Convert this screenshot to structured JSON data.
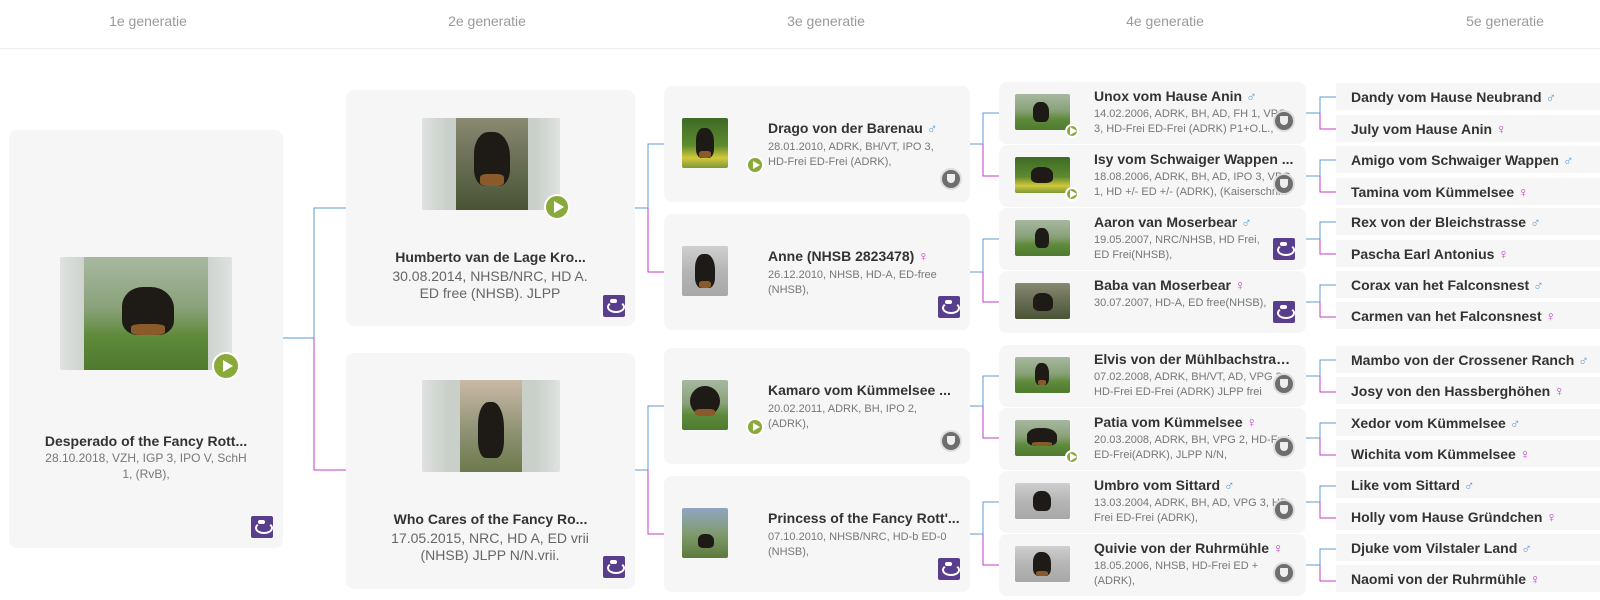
{
  "header": {
    "gen1": "1e generatie",
    "gen2": "2e generatie",
    "gen3": "3e generatie",
    "gen4": "4e generatie",
    "gen5": "5e generatie"
  },
  "colors": {
    "male": "#5b9bd5",
    "female": "#c43cc9",
    "play": "#8aa93b",
    "club": "#5a3e8e"
  },
  "sex_symbols": {
    "male": "♂",
    "female": "♀"
  },
  "gen1": {
    "name": "Desperado of the Fancy Rott...",
    "info": "28.10.2018, VZH, IGP 3, IPO V, SchH 1, (RvB),",
    "icons": [
      "video-play-icon",
      "breed-club-logo-icon"
    ]
  },
  "gen2": [
    {
      "name": "Humberto van de Lage Kro...",
      "info": "30.08.2014, NHSB/NRC, HD A. ED free (NHSB). JLPP",
      "sex": "male"
    },
    {
      "name": "Who Cares of the Fancy Ro...",
      "info": "17.05.2015, NRC, HD A, ED vrii (NHSB) JLPP N/N.vrii.",
      "sex": "female"
    }
  ],
  "gen3": [
    {
      "name": "Drago von der Barenau",
      "sex": "male",
      "info": "28.01.2010, ADRK, BH/VT, IPO 3, HD-Frei ED-Frei (ADRK),",
      "video": true,
      "badge": "shield"
    },
    {
      "name": "Anne (NHSB 2823478)",
      "sex": "female",
      "info": "26.12.2010, NHSB, HD-A, ED-free (NHSB),",
      "video": false,
      "badge": "club"
    },
    {
      "name": "Kamaro vom Kümmelsee ...",
      "sex": "male",
      "info": "20.02.2011, ADRK, BH, IPO 2, (ADRK),",
      "video": true,
      "badge": "shield"
    },
    {
      "name": "Princess of the Fancy Rott'...",
      "sex": "female",
      "info": "07.10.2010, NHSB/NRC, HD-b ED-0 (NHSB),",
      "video": false,
      "badge": "club"
    }
  ],
  "gen4": [
    {
      "name": "Unox vom Hause Anin",
      "sex": "male",
      "info": "14.02.2006, ADRK, BH, AD, FH 1, VPG 3, HD-Frei ED-Frei (ADRK) P1+O.L.,",
      "video": true,
      "badge": "shield"
    },
    {
      "name": "Isy vom Schwaiger Wappen ...",
      "sex": "female",
      "info": "18.08.2006, ADRK, BH, AD, IPO 3, VPG 1, HD +/- ED +/- (ADRK), (Kaiserschnitt",
      "video": true,
      "badge": "shield"
    },
    {
      "name": "Aaron van Moserbear",
      "sex": "male",
      "info": "19.05.2007, NRC/NHSB, HD Frei, ED Frei(NHSB),",
      "video": false,
      "badge": "club"
    },
    {
      "name": "Baba van Moserbear",
      "sex": "female",
      "info": "30.07.2007, HD-A, ED free(NHSB),",
      "video": false,
      "badge": "club"
    },
    {
      "name": "Elvis von der Mühlbachstras...",
      "sex": "male",
      "info": "07.02.2008, ADRK, BH/VT, AD, VPG 3, HD-Frei ED-Frei (ADRK) JLPP frei",
      "video": false,
      "badge": "shield"
    },
    {
      "name": "Patia vom Kümmelsee",
      "sex": "female",
      "info": "20.03.2008, ADRK, BH, VPG 2, HD-Frei ED-Frei(ADRK), JLPP N/N,",
      "video": true,
      "badge": "shield"
    },
    {
      "name": "Umbro vom Sittard",
      "sex": "male",
      "info": "13.03.2004, ADRK, BH, AD, VPG 3, HD-Frei ED-Frei (ADRK),",
      "video": false,
      "badge": "shield"
    },
    {
      "name": "Quivie von der Ruhrmühle",
      "sex": "female",
      "info": "18.05.2006, NHSB, HD-Frei ED + (ADRK),",
      "video": false,
      "badge": "shield"
    }
  ],
  "gen5": [
    {
      "name": "Dandy vom Hause Neubrand",
      "sex": "male"
    },
    {
      "name": "July vom Hause Anin",
      "sex": "female"
    },
    {
      "name": "Amigo vom Schwaiger Wappen",
      "sex": "male"
    },
    {
      "name": "Tamina vom Kümmelsee",
      "sex": "female"
    },
    {
      "name": "Rex von der Bleichstrasse",
      "sex": "male"
    },
    {
      "name": "Pascha Earl Antonius",
      "sex": "female"
    },
    {
      "name": "Corax van het Falconsnest",
      "sex": "male"
    },
    {
      "name": "Carmen van het Falconsnest",
      "sex": "female"
    },
    {
      "name": "Mambo von der Crossener Ranch",
      "sex": "male"
    },
    {
      "name": "Josy von den Hassberghöhen",
      "sex": "female"
    },
    {
      "name": "Xedor vom Kümmelsee",
      "sex": "male"
    },
    {
      "name": "Wichita vom Kümmelsee",
      "sex": "female"
    },
    {
      "name": "Like vom Sittard",
      "sex": "male"
    },
    {
      "name": "Holly vom Hause Gründchen",
      "sex": "female"
    },
    {
      "name": "Djuke vom Vilstaler Land",
      "sex": "male"
    },
    {
      "name": "Naomi von der Ruhrmühle",
      "sex": "female"
    }
  ]
}
